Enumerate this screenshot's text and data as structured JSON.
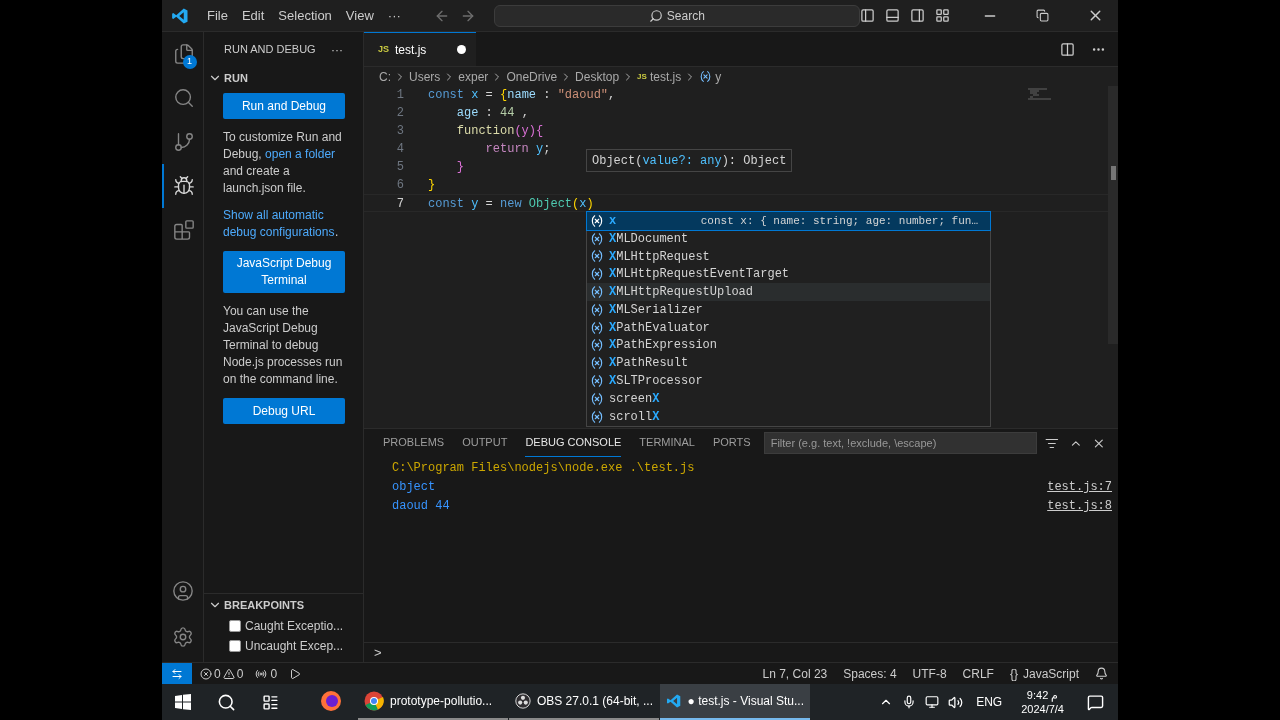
{
  "titlebar": {
    "menus": [
      "File",
      "Edit",
      "Selection",
      "View",
      "···"
    ],
    "search": "Search"
  },
  "activity": [
    {
      "kind": "files",
      "badge": "1",
      "selected": false
    },
    {
      "kind": "search",
      "selected": false
    },
    {
      "kind": "scm",
      "selected": false
    },
    {
      "kind": "debug",
      "selected": true
    },
    {
      "kind": "extensions",
      "selected": false
    }
  ],
  "activity_bottom": [
    {
      "kind": "account"
    },
    {
      "kind": "settings"
    }
  ],
  "sidebar": {
    "title": "RUN AND DEBUG",
    "more": "···",
    "section": {
      "title": "RUN",
      "expanded": true
    },
    "blocks": [
      {
        "kind": "button",
        "label": "Run and Debug"
      },
      {
        "kind": "text",
        "parts": [
          {
            "text": "To customize Run and Debug, ",
            "link": false
          },
          {
            "text": "open a folder",
            "link": true
          },
          {
            "text": " and create a launch.json file.",
            "link": false
          }
        ]
      },
      {
        "kind": "text",
        "parts": [
          {
            "text": "Show all automatic debug configurations",
            "link": true
          },
          {
            "text": ".",
            "link": false
          }
        ]
      },
      {
        "kind": "button",
        "label": "JavaScript Debug Terminal"
      },
      {
        "kind": "text",
        "parts": [
          {
            "text": "You can use the JavaScript Debug Terminal to debug Node.js processes run on the command line.",
            "link": false
          }
        ]
      },
      {
        "kind": "button",
        "label": "Debug URL"
      }
    ],
    "breakpoints": {
      "title": "BREAKPOINTS",
      "expanded": true,
      "items": [
        {
          "label": "Caught Exceptio...",
          "checked": false
        },
        {
          "label": "Uncaught Excep...",
          "checked": false
        }
      ]
    }
  },
  "tab": {
    "icon_text": "JS",
    "label": "test.js",
    "modified": true
  },
  "breadcrumbs": [
    {
      "text": "C:",
      "kind": "folder"
    },
    {
      "text": "Users",
      "kind": "folder"
    },
    {
      "text": "exper",
      "kind": "folder"
    },
    {
      "text": "OneDrive",
      "kind": "folder"
    },
    {
      "text": "Desktop",
      "kind": "folder"
    },
    {
      "text": "test.js",
      "kind": "file",
      "icon_text": "JS"
    },
    {
      "text": "y",
      "kind": "symbol"
    }
  ],
  "code": [
    {
      "number": "1",
      "current": false,
      "tokens": [
        {
          "kind": "kw",
          "t": "const "
        },
        {
          "kind": "var",
          "t": "x"
        },
        {
          "kind": "plain",
          "t": " = "
        },
        {
          "kind": "b1",
          "t": "{"
        },
        {
          "kind": "prop",
          "t": "name"
        },
        {
          "kind": "plain",
          "t": " : "
        },
        {
          "kind": "str",
          "t": "\"daoud\""
        },
        {
          "kind": "plain",
          "t": ","
        }
      ]
    },
    {
      "number": "2",
      "current": false,
      "tokens": [
        {
          "kind": "prop",
          "t": "    age"
        },
        {
          "kind": "plain",
          "t": " : "
        },
        {
          "kind": "num",
          "t": "44"
        },
        {
          "kind": "plain",
          "t": " ,"
        }
      ]
    },
    {
      "number": "3",
      "current": false,
      "tokens": [
        {
          "kind": "fn",
          "t": "    function"
        },
        {
          "kind": "b2",
          "t": "(y){"
        }
      ]
    },
    {
      "number": "4",
      "current": false,
      "tokens": [
        {
          "kind": "ctrl",
          "t": "        return "
        },
        {
          "kind": "var",
          "t": "y"
        },
        {
          "kind": "plain",
          "t": ";"
        }
      ]
    },
    {
      "number": "5",
      "current": false,
      "tokens": [
        {
          "kind": "b2",
          "t": "    }"
        }
      ]
    },
    {
      "number": "6",
      "current": false,
      "tokens": [
        {
          "kind": "b1",
          "t": "}"
        }
      ]
    },
    {
      "number": "7",
      "current": true,
      "tokens": [
        {
          "kind": "kw",
          "t": "const "
        },
        {
          "kind": "var",
          "t": "y"
        },
        {
          "kind": "plain",
          "t": " = "
        },
        {
          "kind": "kw",
          "t": "new "
        },
        {
          "kind": "cls",
          "t": "Object"
        },
        {
          "kind": "b1",
          "t": "("
        },
        {
          "kind": "var",
          "t": "x"
        },
        {
          "kind": "b1",
          "t": ")"
        }
      ]
    }
  ],
  "hint": [
    {
      "kind": "plain",
      "t": "Object("
    },
    {
      "kind": "param",
      "t": "value?: "
    },
    {
      "kind": "type",
      "t": "any"
    },
    {
      "kind": "plain",
      "t": "): Object"
    }
  ],
  "suggestions": [
    {
      "match": "x",
      "detail": "const x: { name: string; age: number; fun…",
      "selected": true,
      "hovered": false
    },
    {
      "match": "X",
      "after": "MLDocument",
      "selected": false,
      "hovered": false
    },
    {
      "match": "X",
      "after": "MLHttpRequest",
      "selected": false,
      "hovered": false
    },
    {
      "match": "X",
      "after": "MLHttpRequestEventTarget",
      "selected": false,
      "hovered": false
    },
    {
      "match": "X",
      "after": "MLHttpRequestUpload",
      "selected": false,
      "hovered": true
    },
    {
      "match": "X",
      "after": "MLSerializer",
      "selected": false,
      "hovered": false
    },
    {
      "match": "X",
      "after": "PathEvaluator",
      "selected": false,
      "hovered": false
    },
    {
      "match": "X",
      "after": "PathExpression",
      "selected": false,
      "hovered": false
    },
    {
      "match": "X",
      "after": "PathResult",
      "selected": false,
      "hovered": false
    },
    {
      "match": "X",
      "after": "SLTProcessor",
      "selected": false,
      "hovered": false
    },
    {
      "before": "screen",
      "match": "X",
      "selected": false,
      "hovered": false
    },
    {
      "before": "scroll",
      "match": "X",
      "selected": false,
      "hovered": false
    }
  ],
  "panel": {
    "tabs": [
      {
        "label": "PROBLEMS",
        "selected": false
      },
      {
        "label": "OUTPUT",
        "selected": false
      },
      {
        "label": "DEBUG CONSOLE",
        "selected": true
      },
      {
        "label": "TERMINAL",
        "selected": false
      },
      {
        "label": "PORTS",
        "selected": false
      }
    ],
    "filter_placeholder": "Filter (e.g. text, !exclude, \\escape)",
    "lines": [
      {
        "kind": "command",
        "text": "C:\\Program Files\\nodejs\\node.exe .\\test.js"
      },
      {
        "kind": "output",
        "text": "object",
        "source": "test.js:7"
      },
      {
        "kind": "output",
        "text": "daoud 44",
        "source": "test.js:8"
      }
    ],
    "prompt": ">"
  },
  "status": {
    "errors": "0",
    "warnings": "0",
    "ports": "0",
    "right": [
      "Ln 7, Col 23",
      "Spaces: 4",
      "UTF-8",
      "CRLF"
    ],
    "language": "JavaScript",
    "language_icon": "{}"
  },
  "taskbar": {
    "apps": [
      {
        "kind": "firefox",
        "selected": false
      },
      {
        "kind": "chrome",
        "label": "prototype-pollutio...",
        "selected": false
      },
      {
        "kind": "obs",
        "label": "OBS 27.0.1 (64-bit, ...",
        "selected": false
      },
      {
        "kind": "vscode",
        "label": "● test.js - Visual Stu...",
        "selected": true
      }
    ],
    "lang": "ENG",
    "time": "9:42 م",
    "date": "2024/7/4"
  }
}
